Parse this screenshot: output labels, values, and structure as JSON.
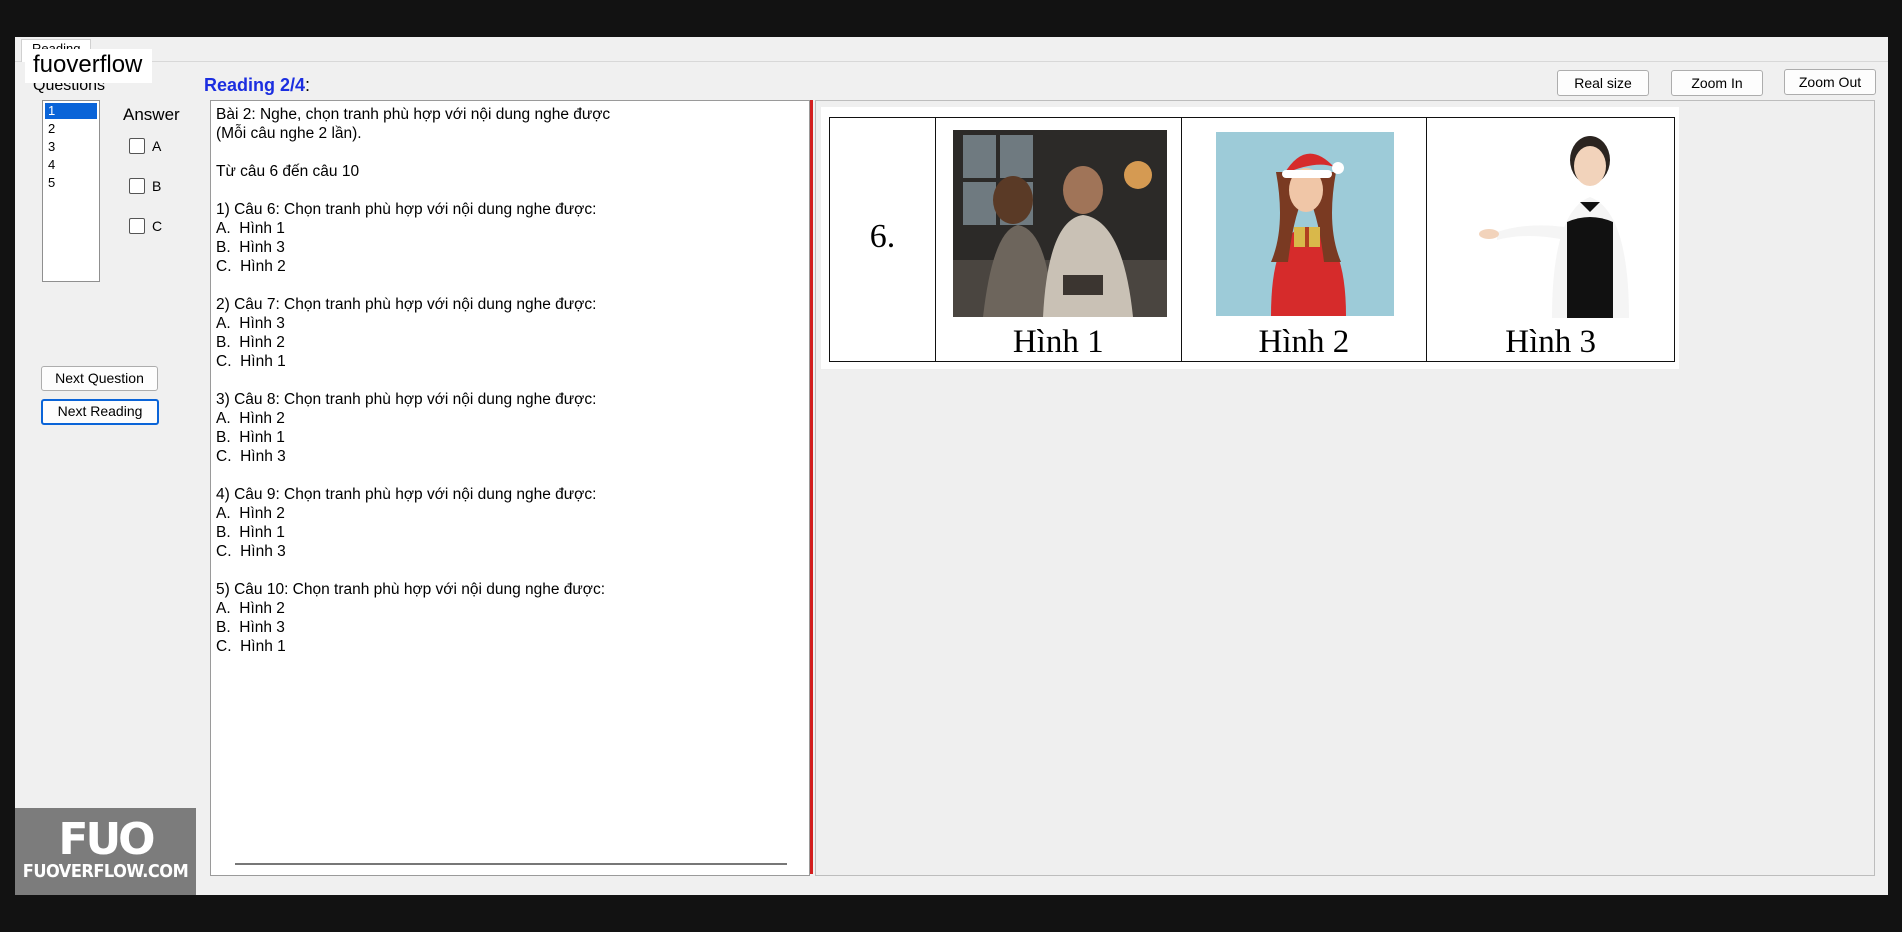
{
  "app": {
    "tab_label": "Reading",
    "watermark": "fuoverflow"
  },
  "questions": {
    "label": "Questions",
    "items": [
      "1",
      "2",
      "3",
      "4",
      "5"
    ],
    "selected": "1"
  },
  "answer": {
    "label": "Answer",
    "options": [
      "A",
      "B",
      "C"
    ]
  },
  "buttons": {
    "next_question": "Next Question",
    "next_reading": "Next Reading"
  },
  "reading": {
    "title": "Reading 2/4",
    "colon": ":"
  },
  "passage": {
    "lines": [
      "Bài 2: Nghe, chọn tranh phù hợp với nội dung nghe được",
      "(Mỗi câu nghe 2 lần).",
      "",
      "Từ câu 6 đến câu 10",
      "",
      "1) Câu 6: Chọn tranh phù hợp với nội dung nghe được:",
      "A.  Hình 1",
      "B.  Hình 3",
      "C.  Hình 2",
      "",
      "2) Câu 7: Chọn tranh phù hợp với nội dung nghe được:",
      "A.  Hình 3",
      "B.  Hình 2",
      "C.  Hình 1",
      "",
      "3) Câu 8: Chọn tranh phù hợp với nội dung nghe được:",
      "A.  Hình 2",
      "B.  Hình 1",
      "C.  Hình 3",
      "",
      "4) Câu 9: Chọn tranh phù hợp với nội dung nghe được:",
      "A.  Hình 2",
      "B.  Hình 1",
      "C.  Hình 3",
      "",
      "5) Câu 10: Chọn tranh phù hợp với nội dung nghe được:",
      "A.  Hình 2",
      "B.  Hình 3",
      "C.  Hình 1"
    ]
  },
  "image": {
    "number": "6.",
    "captions": [
      "Hình 1",
      "Hình 2",
      "Hình 3"
    ]
  },
  "zoom": {
    "real_size": "Real size",
    "zoom_in": "Zoom In",
    "zoom_out": "Zoom Out"
  },
  "logo": {
    "mark": "FUO",
    "url": "FUOVERFLOW.COM"
  },
  "colors": {
    "accent": "#0a64d8",
    "title_blue": "#1b2ee0",
    "splitter_red": "#d31e1e"
  }
}
